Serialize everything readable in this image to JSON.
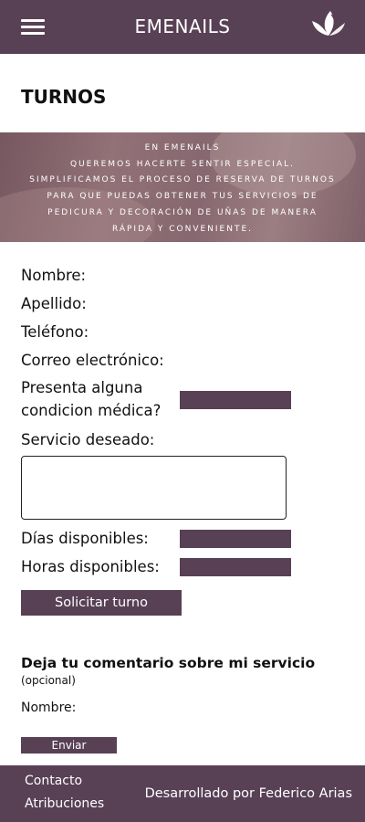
{
  "header": {
    "brand": "EMENAILS",
    "menu_icon": "hamburger-menu-icon",
    "logo_icon": "lotus-flower-logo",
    "color": "#584055"
  },
  "page": {
    "title": "TURNOS"
  },
  "banner": {
    "lines": [
      "EN EMENAILS",
      "QUEREMOS HACERTE SENTIR ESPECIAL.",
      "SIMPLIFICAMOS EL PROCESO DE RESERVA DE TURNOS",
      "PARA QUE PUEDAS OBTENER TUS SERVICIOS DE",
      "PEDICURA Y DECORACIÓN DE UÑAS DE MANERA",
      "RÁPIDA Y CONVENIENTE."
    ]
  },
  "form": {
    "nombre": "Nombre:",
    "apellido": "Apellido:",
    "telefono": "Teléfono:",
    "correo": "Correo electrónico:",
    "condicion_line1": "Presenta alguna",
    "condicion_line2": "condicion médica?",
    "servicio": "Servicio deseado:",
    "dias": "Días disponibles:",
    "horas": "Horas disponibles:",
    "submit": "Solicitar turno"
  },
  "comment": {
    "title": "Deja tu comentario sobre mi servicio",
    "subtitle": "(opcional)",
    "nombre": "Nombre:",
    "submit": "Enviar"
  },
  "footer": {
    "contacto": "Contacto",
    "atribuciones": "Atribuciones",
    "credit": "Desarrollado por Federico Arias"
  }
}
